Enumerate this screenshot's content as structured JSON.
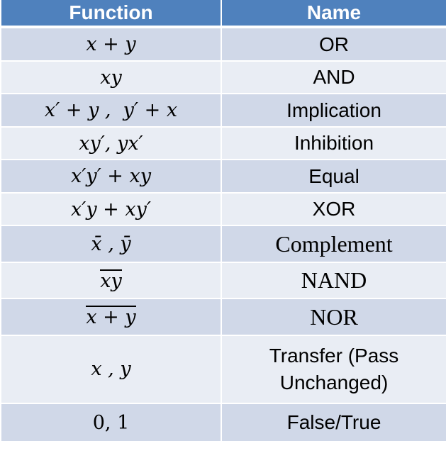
{
  "table": {
    "headers": {
      "function": "Function",
      "name": "Name"
    },
    "header_color": "#4F81BD",
    "row_colors": {
      "odd": "#D0D8E8",
      "even": "#E9EDF4"
    },
    "rows": [
      {
        "function": "x + y",
        "name": "OR"
      },
      {
        "function": "xy",
        "name": "AND"
      },
      {
        "function": "x′ + y ,  y′ + x",
        "name": "Implication"
      },
      {
        "function": "xy′, yx′",
        "name": "Inhibition"
      },
      {
        "function": "x′y′ + xy",
        "name": "Equal"
      },
      {
        "function": "x′y + xy′",
        "name": "XOR"
      },
      {
        "function_a": "x̄",
        "function_sep": " , ",
        "function_b": "ȳ",
        "name": "Complement"
      },
      {
        "function": "xy",
        "function_note": "overlined (NOT of xy)",
        "name": "NAND"
      },
      {
        "function": "x + y",
        "function_note": "overlined (NOT of x + y)",
        "name": "NOR"
      },
      {
        "function": "x , y",
        "name_line1": "Transfer (Pass",
        "name_line2": "Unchanged)"
      },
      {
        "function": "0, 1",
        "name": "False/True"
      }
    ]
  }
}
